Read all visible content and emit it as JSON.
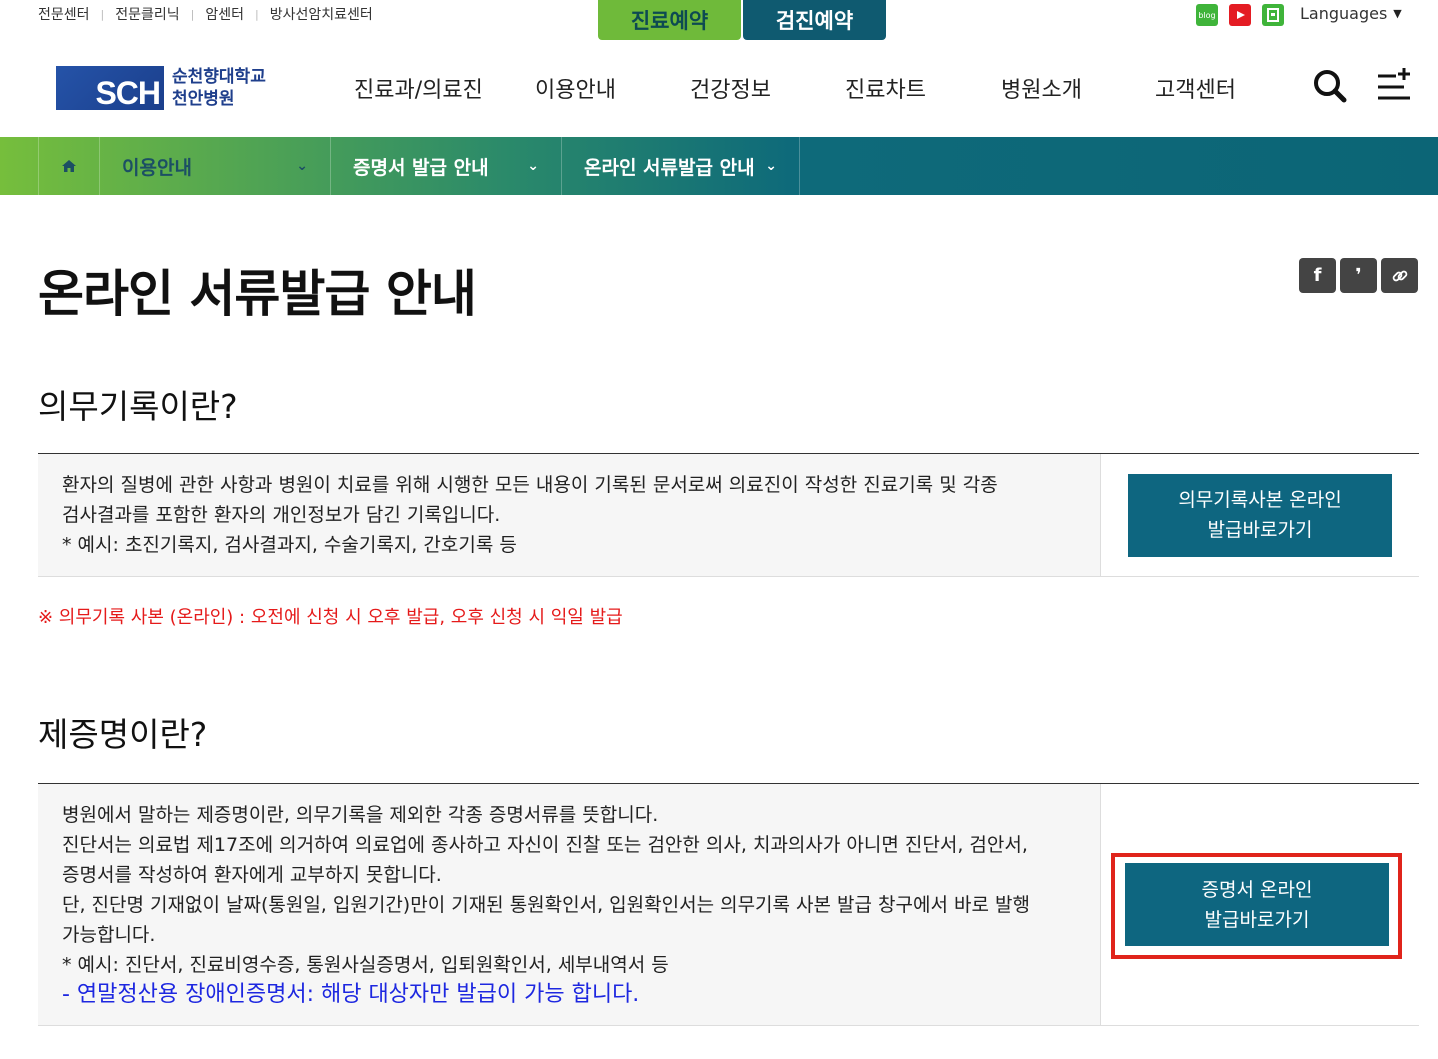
{
  "utility": {
    "links": [
      "전문센터",
      "전문클리닉",
      "암센터",
      "방사선암치료센터"
    ],
    "reserve_treatment": "진료예약",
    "reserve_checkup": "검진예약",
    "sns": [
      "blog-icon",
      "youtube-icon",
      "store-icon"
    ],
    "sns_blog_text": "blog",
    "languages": "Languages"
  },
  "logo": {
    "mark": "SCH",
    "line1": "순천향대학교",
    "line2": "천안병원"
  },
  "gnb": [
    "진료과/의료진",
    "이용안내",
    "건강정보",
    "진료차트",
    "병원소개",
    "고객센터"
  ],
  "location": {
    "level1": "이용안내",
    "level2": "증명서 발급 안내",
    "level3": "온라인 서류발급 안내"
  },
  "page_title": "온라인 서류발급 안내",
  "share": {
    "facebook": "f",
    "kakao": "❜"
  },
  "section1": {
    "heading": "의무기록이란?",
    "lines": [
      "환자의 질병에 관한 사항과 병원이 치료를 위해 시행한 모든 내용이 기록된 문서로써 의료진이 작성한 진료기록 및 각종",
      "검사결과를 포함한 환자의 개인정보가 담긴 기록입니다.",
      "* 예시: 초진기록지, 검사결과지, 수술기록지, 간호기록 등"
    ],
    "button_line1": "의무기록사본 온라인",
    "button_line2": "발급바로가기"
  },
  "notice": "※ 의무기록 사본 (온라인) : 오전에 신청 시 오후 발급, 오후 신청 시 익일 발급",
  "section2": {
    "heading": "제증명이란?",
    "lines": [
      "병원에서 말하는 제증명이란, 의무기록을 제외한 각종 증명서류를 뜻합니다.",
      "진단서는 의료법 제17조에 의거하여 의료업에 종사하고 자신이 진찰 또는 검안한 의사, 치과의사가 아니면 진단서, 검안서,",
      "증명서를 작성하여 환자에게 교부하지 못합니다.",
      "단, 진단명 기재없이 날짜(통원일, 입원기간)만이 기재된 통원확인서, 입원확인서는 의무기록 사본 발급 창구에서 바로 발행",
      "가능합니다.",
      "* 예시: 진단서, 진료비영수증, 통원사실증명서, 입퇴원확인서, 세부내역서 등"
    ],
    "blue_line": "- 연말정산용 장애인증명서: 해당 대상자만 발급이 가능 합니다.",
    "button_line1": "증명서 온라인",
    "button_line2": "발급바로가기"
  }
}
